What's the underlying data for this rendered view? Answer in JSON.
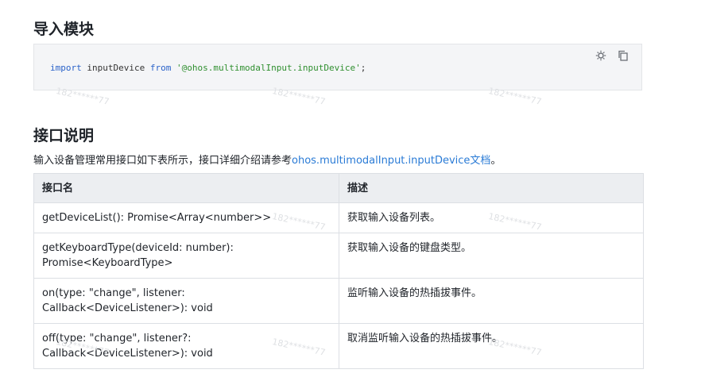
{
  "sections": {
    "import_title": "导入模块",
    "api_title": "接口说明"
  },
  "code": {
    "kw_import": "import",
    "ident": " inputDevice ",
    "kw_from": "from",
    "space": " ",
    "module": "'@ohos.multimodalInput.inputDevice'",
    "semicolon": ";",
    "icons": [
      "theme-toggle-icon",
      "copy-icon"
    ]
  },
  "intro": {
    "text": "输入设备管理常用接口如下表所示，接口详细介绍请参考",
    "link": "ohos.multimodalInput.inputDevice文档",
    "suffix": "。"
  },
  "table": {
    "headers": [
      "接口名",
      "描述"
    ],
    "rows": [
      {
        "name": "getDeviceList(): Promise<Array<number>>",
        "desc": "获取输入设备列表。"
      },
      {
        "name": "getKeyboardType(deviceId: number): Promise<KeyboardType>",
        "desc": "获取输入设备的键盘类型。"
      },
      {
        "name": "on(type: \"change\", listener: Callback<DeviceListener>): void",
        "desc": "监听输入设备的热插拔事件。"
      },
      {
        "name": "off(type: \"change\", listener?: Callback<DeviceListener>): void",
        "desc": "取消监听输入设备的热插拔事件。"
      }
    ]
  },
  "watermark": "182******77"
}
